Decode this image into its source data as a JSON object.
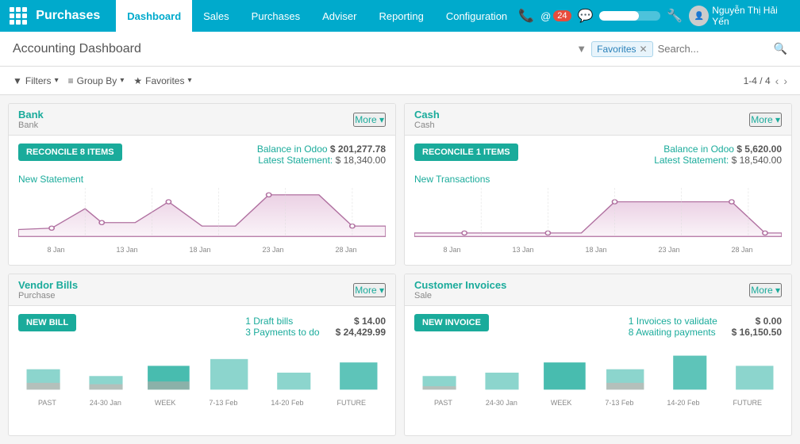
{
  "app": {
    "title": "Purchases",
    "grid_icon": "apps-icon"
  },
  "navbar": {
    "items": [
      {
        "label": "Dashboard",
        "active": true
      },
      {
        "label": "Sales",
        "active": false
      },
      {
        "label": "Purchases",
        "active": false
      },
      {
        "label": "Adviser",
        "active": false
      },
      {
        "label": "Reporting",
        "active": false
      },
      {
        "label": "Configuration",
        "active": false
      }
    ],
    "phone_icon": "📞",
    "badge_count": "@ 24",
    "chat_icon": "💬",
    "settings_icon": "⚙",
    "user_name": "Nguyễn Thị Hải Yến"
  },
  "header": {
    "title": "Accounting Dashboard",
    "filter_tag": "Favorites",
    "search_placeholder": "Search...",
    "filters_label": "Filters",
    "group_by_label": "Group By",
    "favorites_label": "Favorites",
    "pagination": "1-4 / 4"
  },
  "cards": {
    "bank": {
      "title": "Bank",
      "subtitle": "Bank",
      "more_label": "More ▾",
      "action_label": "RECONCILE 8 ITEMS",
      "balance_label": "Balance in Odoo",
      "balance_value": "$ 201,277.78",
      "statement_label": "Latest Statement:",
      "statement_value": "$ 18,340.00",
      "link": "New Statement",
      "chart_dates": [
        "8 Jan",
        "13 Jan",
        "18 Jan",
        "23 Jan",
        "28 Jan"
      ]
    },
    "cash": {
      "title": "Cash",
      "subtitle": "Cash",
      "more_label": "More ▾",
      "action_label": "RECONCILE 1 ITEMS",
      "balance_label": "Balance in Odoo",
      "balance_value": "$ 5,620.00",
      "statement_label": "Latest Statement:",
      "statement_value": "$ 18,540.00",
      "link": "New Transactions",
      "chart_dates": [
        "8 Jan",
        "13 Jan",
        "18 Jan",
        "23 Jan",
        "28 Jan"
      ]
    },
    "vendor_bills": {
      "title": "Vendor Bills",
      "subtitle": "Purchase",
      "more_label": "More ▾",
      "action_label": "NEW BILL",
      "stat1_label": "1 Draft bills",
      "stat1_value": "$ 14.00",
      "stat2_label": "3 Payments to do",
      "stat2_value": "$ 24,429.99",
      "chart_dates": [
        "PAST",
        "24-30 Jan",
        "WEEK",
        "7-13 Feb",
        "14-20 Feb",
        "FUTURE"
      ]
    },
    "customer_invoices": {
      "title": "Customer Invoices",
      "subtitle": "Sale",
      "more_label": "More ▾",
      "action_label": "NEW INVOICE",
      "stat1_label": "1 Invoices to validate",
      "stat1_value": "$ 0.00",
      "stat2_label": "8 Awaiting payments",
      "stat2_value": "$ 16,150.50",
      "chart_dates": [
        "PAST",
        "24-30 Jan",
        "WEEK",
        "7-13 Feb",
        "14-20 Feb",
        "FUTURE"
      ]
    }
  }
}
